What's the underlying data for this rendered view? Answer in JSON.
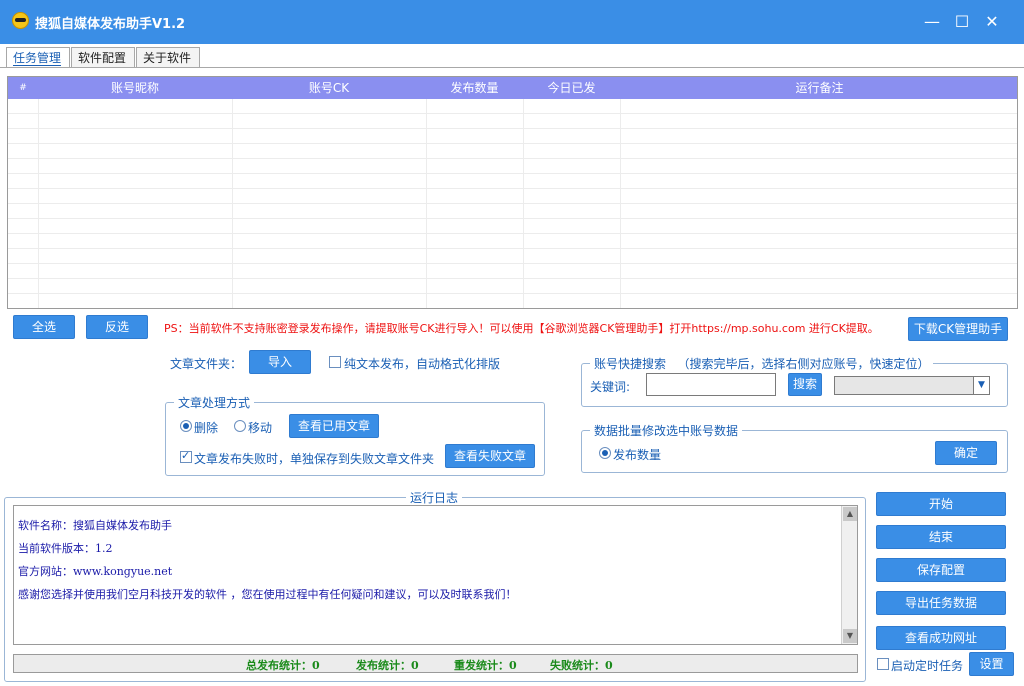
{
  "window": {
    "title": "搜狐自媒体发布助手V1.2",
    "controls": {
      "minimize": "—",
      "maximize": "☐",
      "close": "✕"
    }
  },
  "tabs": [
    {
      "label": "任务管理",
      "active": true
    },
    {
      "label": "软件配置",
      "active": false
    },
    {
      "label": "关于软件",
      "active": false
    }
  ],
  "grid": {
    "header_color": "#8a8ff0",
    "columns": [
      "#",
      "账号昵称",
      "账号CK",
      "发布数量",
      "今日已发",
      "运行备注"
    ],
    "rows": []
  },
  "actions": {
    "select_all": "全选",
    "invert": "反选",
    "notice": "PS：当前软件不支持账密登录发布操作，请提取账号CK进行导入！可以使用【谷歌浏览器CK管理助手】打开https://mp.sohu.com 进行CK提取。",
    "download_ck": "下载CK管理助手"
  },
  "article": {
    "folder_label": "文章文件夹：",
    "import": "导入",
    "plain_text_label": "纯文本发布，自动格式化排版",
    "plain_text_checked": false
  },
  "processing": {
    "legend": "文章处理方式",
    "delete_label": "删除",
    "move_label": "移动",
    "selected": "删除",
    "view_used": "查看已用文章",
    "save_failed_label": "文章发布失败时，单独保存到失败文章文件夹",
    "save_failed_checked": true,
    "view_failed": "查看失败文章"
  },
  "search": {
    "legend": "账号快捷搜索",
    "hint": "（搜索完毕后，选择右侧对应账号，快速定位）",
    "keyword_label": "关键词:",
    "keyword_value": "",
    "search_button": "搜索",
    "account_selected": "",
    "dropdown_arrow": "chevron-down-icon"
  },
  "batch": {
    "legend": "数据批量修改选中账号数据",
    "option_label": "发布数量",
    "option_selected": true,
    "confirm": "确定"
  },
  "log": {
    "legend": "运行日志",
    "lines": [
      "软件名称：搜狐自媒体发布助手",
      "当前软件版本：1.2",
      "官方网站：www.kongyue.net",
      "感谢您选择并使用我们空月科技开发的软件 ，您在使用过程中有任何疑问和建议，可以及时联系我们！"
    ],
    "scroll_up": "▲",
    "scroll_down": "▼"
  },
  "stats": {
    "total_label": "总发布统计：",
    "total_value": "0",
    "published_label": "发布统计：",
    "published_value": "0",
    "repost_label": "重发统计：",
    "repost_value": "0",
    "failed_label": "失败统计：",
    "failed_value": "0"
  },
  "side": {
    "start": "开始",
    "end": "结束",
    "save_config": "保存配置",
    "export_tasks": "导出任务数据",
    "view_success": "查看成功网址",
    "auto_timer_label": "启动定时任务",
    "auto_timer_checked": false,
    "settings": "设置"
  }
}
